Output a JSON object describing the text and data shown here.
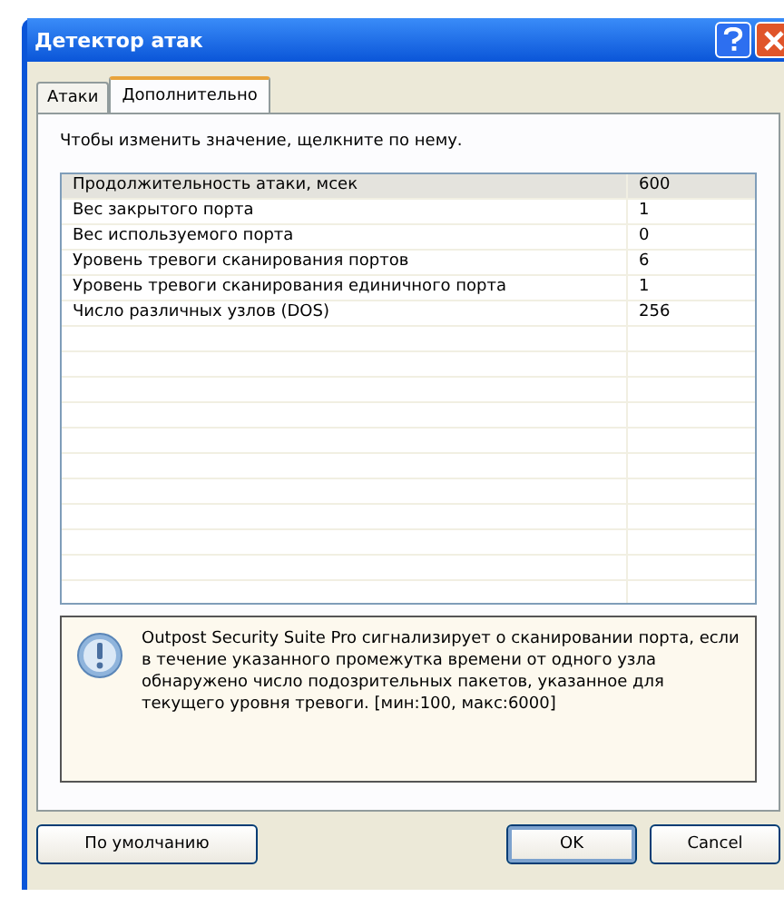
{
  "window": {
    "title": "Детектор атак"
  },
  "tabs": [
    {
      "label": "Атаки",
      "selected": false
    },
    {
      "label": "Дополнительно",
      "selected": true
    }
  ],
  "hint": "Чтобы изменить значение, щелкните по нему.",
  "rows": [
    {
      "name": "Продолжительность атаки, мсек",
      "value": "600",
      "selected": true
    },
    {
      "name": "Вес закрытого порта",
      "value": "1",
      "selected": false
    },
    {
      "name": "Вес используемого порта",
      "value": "0",
      "selected": false
    },
    {
      "name": "Уровень тревоги сканирования портов",
      "value": "6",
      "selected": false
    },
    {
      "name": "Уровень тревоги сканирования единичного порта",
      "value": "1",
      "selected": false
    },
    {
      "name": "Число различных узлов (DOS)",
      "value": "256",
      "selected": false
    }
  ],
  "info": "Outpost Security Suite Pro сигнализирует о сканировании порта, если в течение указанного промежутка времени от одного узла обнаружено число подозрительных пакетов, указанное для текущего уровня тревоги. [мин:100, макс:6000]",
  "buttons": [
    {
      "label": "По умолчанию",
      "kind": "default"
    },
    {
      "label": "OK",
      "kind": "primary"
    },
    {
      "label": "Cancel",
      "kind": "normal"
    }
  ]
}
